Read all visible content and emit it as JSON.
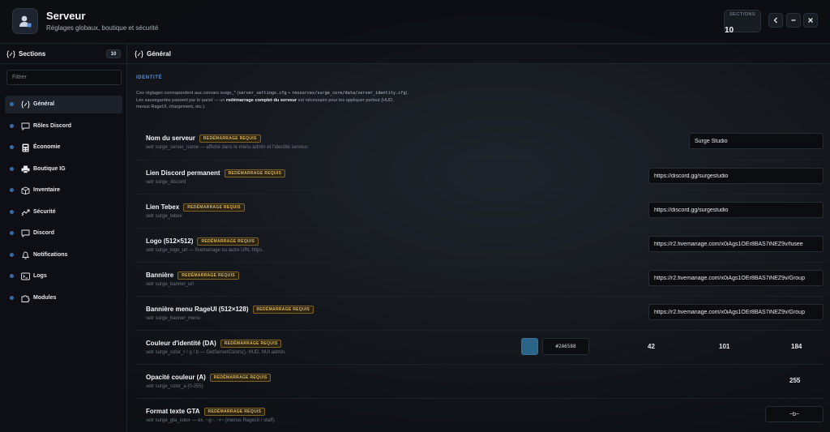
{
  "header": {
    "title": "Serveur",
    "subtitle": "Réglages globaux, boutique et sécurité",
    "sections_count": "10",
    "sections_label": "SECTIONS"
  },
  "sidebar": {
    "title": "Sections",
    "count": "10",
    "filter_placeholder": "Filtrer",
    "items": [
      {
        "label": "Général",
        "icon": "code-braces-icon",
        "active": true
      },
      {
        "label": "Rôles Discord",
        "icon": "chat-bubble-icon",
        "active": false
      },
      {
        "label": "Économie",
        "icon": "calculator-icon",
        "active": false
      },
      {
        "label": "Boutique IG",
        "icon": "printer-icon",
        "active": false
      },
      {
        "label": "Inventaire",
        "icon": "box-icon",
        "active": false
      },
      {
        "label": "Sécurité",
        "icon": "shield-icon",
        "active": false
      },
      {
        "label": "Discord",
        "icon": "chat-bubble-icon",
        "active": false
      },
      {
        "label": "Notifications",
        "icon": "bell-icon",
        "active": false
      },
      {
        "label": "Logs",
        "icon": "terminal-icon",
        "active": false
      },
      {
        "label": "Modules",
        "icon": "puzzle-icon",
        "active": false
      }
    ]
  },
  "main": {
    "title": "Général",
    "section_label": "IDENTITÉ",
    "desc_1": "Ces réglages correspondent aux convars surge_* (",
    "desc_code_1": "server_settings.cfg",
    "desc_2": " + ",
    "desc_code_2": "resources/surge_core/data/server_identity.cfg",
    "desc_3": ").",
    "desc_4": "Les sauvegardes passent par le panel — un ",
    "desc_bold": "redémarrage complet du serveur",
    "desc_5": " est nécessaire pour les appliquer partout (HUD,",
    "desc_6": "menus RageUI, chargement, etc.).",
    "restart_badge": "REDÉMARRAGE REQUIS",
    "rows": [
      {
        "title": "Nom du serveur",
        "hint": "setr surge_server_name — affiché dans le menu admin et l'identité serveur.",
        "value": "Surge Studio"
      },
      {
        "title": "Lien Discord permanent",
        "hint": "setr surge_discord",
        "value": "https://discord.gg/surgestudio"
      },
      {
        "title": "Lien Tebex",
        "hint": "setr surge_tebex",
        "value": "https://discord.gg/surgestudio"
      },
      {
        "title": "Logo (512×512)",
        "hint": "setr surge_logo_url — fivemanage ou autre URL https.",
        "value": "https://r2.fivemanage.com/x0iAgs1OEr8BAS7iNEZ9v/fusee"
      },
      {
        "title": "Bannière",
        "hint": "setr surge_banner_url",
        "value": "https://r2.fivemanage.com/x0iAgs1OEr8BAS7iNEZ9v/Group"
      },
      {
        "title": "Bannière menu RageUI (512×128)",
        "hint": "setr surge_banner_menu",
        "value": "https://r2.fivemanage.com/x0iAgs1OEr8BAS7iNEZ9v/Group"
      }
    ],
    "color_row": {
      "title": "Couleur d'identité (DA)",
      "hint": "setr surge_color_r / g / b — GetServerColors(), HUD, NUI admin.",
      "swatch": "#2A6588",
      "hex": "#2A6588",
      "r": "42",
      "g": "101",
      "b": "184"
    },
    "opacity_row": {
      "title": "Opacité couleur (A)",
      "hint": "setr surge_color_a (0-255)",
      "value": "255"
    },
    "format_row": {
      "title": "Format texte GTA",
      "hint": "setr surge_gta_color — ex. ~g~, ~r~ (menus RageUI / staff).",
      "value": "~b~"
    }
  }
}
